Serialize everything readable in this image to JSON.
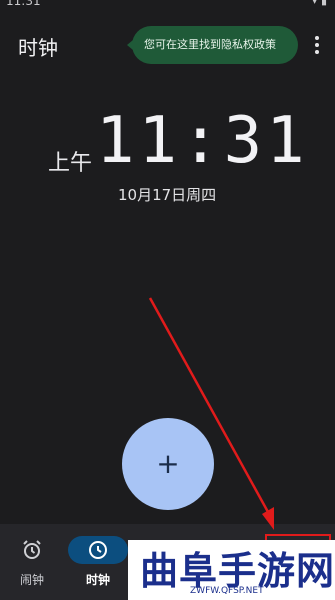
{
  "status": {
    "time": "11:31",
    "icons": "▾ ▮"
  },
  "app": {
    "title": "时钟",
    "tooltip": "您可在这里找到隐私权政策"
  },
  "clock": {
    "ampm": "上午",
    "time": "11:31",
    "date": "10月17日周四"
  },
  "fab": {
    "label": "+"
  },
  "nav": {
    "items": [
      {
        "label": "闹钟",
        "icon": "alarm-icon",
        "active": false
      },
      {
        "label": "时钟",
        "icon": "clock-icon",
        "active": true
      }
    ]
  },
  "overlay": {
    "watermark": "曲阜手游网",
    "watermark_url": "ZWFW.QFSP.NET",
    "arrow_color": "#e11b1b",
    "highlight_color": "#e11b1b"
  },
  "colors": {
    "background": "#1c1c1e",
    "tooltip_bg": "#1f5a38",
    "fab_bg": "#a8c4f5",
    "nav_active_bg": "#0c4e7f"
  }
}
